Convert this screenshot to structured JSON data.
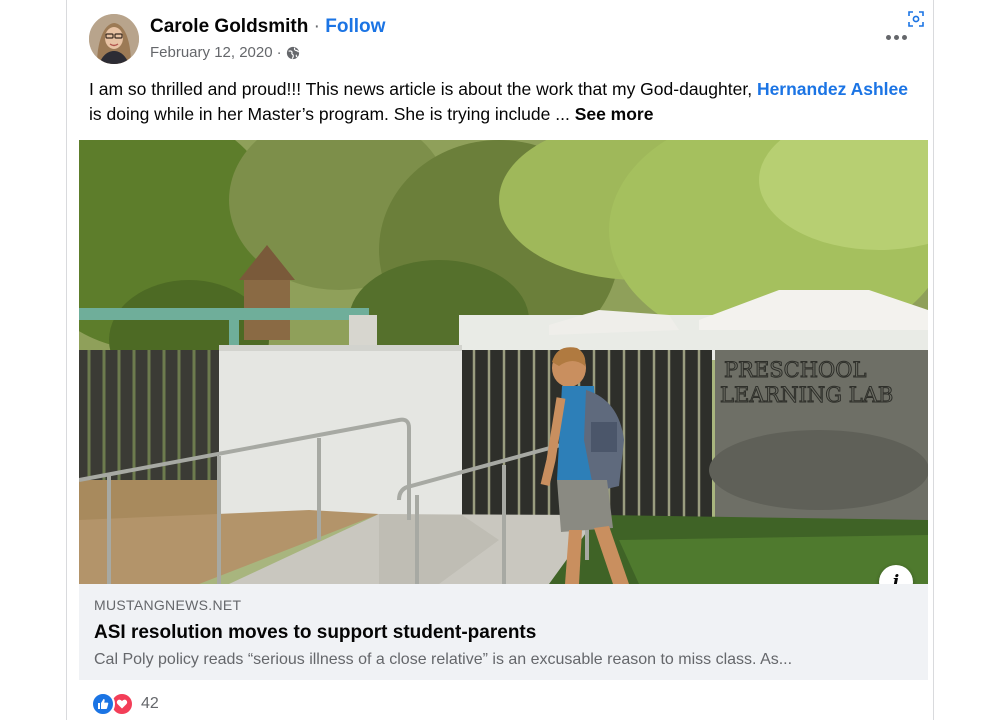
{
  "post": {
    "author": "Carole Goldsmith",
    "separator": "·",
    "follow_label": "Follow",
    "date": "February 12, 2020",
    "date_separator": "·",
    "privacy_icon": "globe-icon",
    "text_before": "I am so thrilled and proud!!! This news article is about the work that my God-daughter, ",
    "mention": "Hernandez Ashlee",
    "text_after": " is doing while in her Master’s program.  She is trying include ... ",
    "see_more_label": "See more"
  },
  "link_preview": {
    "domain": "MUSTANGNEWS.NET",
    "title": "ASI resolution moves to support student-parents",
    "description": "Cal Poly policy reads “serious illness of a close relative” is an excusable reason to miss class. As...",
    "sign_text": "PRESCHOOL LEARNING LAB",
    "info_icon": "i"
  },
  "reactions": {
    "types": [
      "like",
      "love"
    ],
    "count": "42"
  },
  "colors": {
    "link_blue": "#1b74e4",
    "secondary_text": "#65676b",
    "preview_bg": "#f0f2f5",
    "love_red": "#f33e58"
  }
}
